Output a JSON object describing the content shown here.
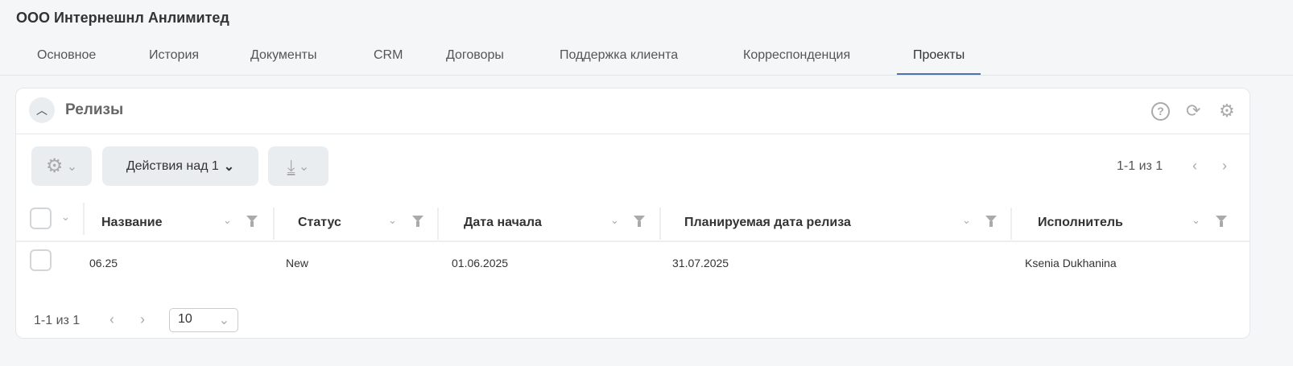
{
  "header": {
    "title": "ООО Интернешнл Анлимитед"
  },
  "tabs": [
    {
      "label": "Основное"
    },
    {
      "label": "История"
    },
    {
      "label": "Документы"
    },
    {
      "label": "CRM"
    },
    {
      "label": "Договоры"
    },
    {
      "label": "Поддержка клиента"
    },
    {
      "label": "Корреспонденция"
    },
    {
      "label": "Проекты",
      "active": true
    }
  ],
  "section": {
    "title": "Релизы"
  },
  "toolbar": {
    "actions_label": "Действия над 1",
    "pagination": "1-1 из 1"
  },
  "table": {
    "columns": [
      "Название",
      "Статус",
      "Дата начала",
      "Планируемая дата релиза",
      "Исполнитель"
    ],
    "rows": [
      {
        "name": "06.25",
        "status": "New",
        "start": "01.06.2025",
        "planned": "31.07.2025",
        "assignee": "Ksenia Dukhanina"
      }
    ]
  },
  "footer": {
    "pagination": "1-1 из 1",
    "page_size": "10"
  },
  "colors": {
    "accent": "#4a72b5",
    "background": "#f5f6f8"
  }
}
